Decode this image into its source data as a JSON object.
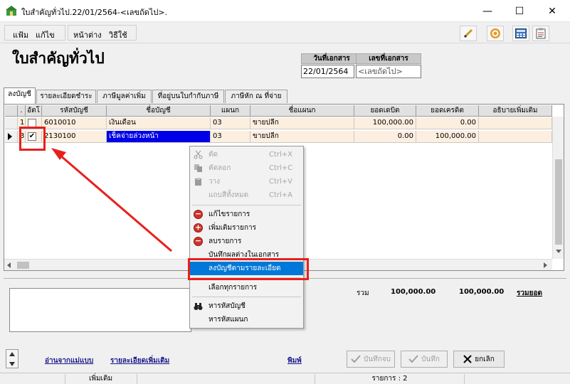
{
  "window": {
    "title": "ใบสำคัญทั่วไป.22/01/2564-<เลขถัดไป>.",
    "minimize": "—",
    "maximize": "☐",
    "close": "✕"
  },
  "menu": {
    "file": "แฟ้ม",
    "edit": "แก้ไข",
    "window": "หน้าต่าง",
    "help": "วิธีใช้"
  },
  "toolbar_icons": [
    "pen-icon",
    "target-icon",
    "calculator-icon",
    "clipboard-icon"
  ],
  "page": {
    "heading": "ใบสำคัญทั่วไป"
  },
  "doc": {
    "date_label": "วันที่เอกสาร",
    "date_value": "22/01/2564",
    "number_label": "เลขที่เอกสาร",
    "number_value": "<เลขถัดไป>"
  },
  "tabs": [
    "ลงบัญชี",
    "รายละเอียดชำระ",
    "ภาษีมูลค่าเพิ่ม",
    "ที่อยู่บนใบกำกับภาษี",
    "ภาษีหัก ณ ที่จ่าย"
  ],
  "grid": {
    "columns": [
      ".",
      "อัตโ",
      "รหัสบัญชี",
      "ชื่อบัญชี",
      "แผนก",
      "ชื่อแผนก",
      "ยอดเดบิต",
      "ยอดเครดิต",
      "อธิบายเพิ่มเติม"
    ],
    "rows": [
      {
        "no": "1",
        "checked": "",
        "code": "6010010",
        "name": "เงินเดือน",
        "dept": "03",
        "dept_name": "ขายปลีก",
        "debit": "100,000.00",
        "credit": "0.00",
        "note": ""
      },
      {
        "no": "3",
        "checked": "✔",
        "code": "2130100",
        "name": "เช็คจ่ายล่วงหน้า",
        "dept": "03",
        "dept_name": "ขายปลีก",
        "debit": "0.00",
        "credit": "100,000.00",
        "note": ""
      }
    ]
  },
  "context_menu": {
    "cut": "ตัด",
    "cut_sc": "Ctrl+X",
    "copy": "คัดลอก",
    "copy_sc": "Ctrl+C",
    "paste": "วาง",
    "paste_sc": "Ctrl+V",
    "paste_all": "แถบสีทั้งหมด",
    "paste_all_sc": "Ctrl+A",
    "edit_item": "แก้ไขรายการ",
    "add_item": "เพิ่มเติมรายการ",
    "delete_item": "ลบรายการ",
    "save_diff": "บันทึกผลต่างในเอกสาร",
    "post_detail": "ลงบัญชีตามรายละเอียด",
    "select_all": "เลือกทุกรายการ",
    "find_account": "หารหัสบัญชี",
    "find_dept": "หารหัสแผนก"
  },
  "totals": {
    "label": "รวม",
    "debit": "100,000.00",
    "credit": "100,000.00",
    "total_link": "รวมยอด"
  },
  "bottom_links": {
    "read_template": "อ่านจากแม่แบบ",
    "more_detail": "รายละเอียดเพิ่มเติม",
    "print": "พิมพ์"
  },
  "buttons": {
    "save_draft": "บันทึกจบ",
    "save": "บันทึก",
    "cancel": "ยกเลิก"
  },
  "status": {
    "mode": "เพิ่มเติม",
    "items": "รายการ : 2"
  },
  "colors": {
    "accent": "#0078d7",
    "annotation": "#e8201c",
    "row_bg": "#fcefe0"
  }
}
